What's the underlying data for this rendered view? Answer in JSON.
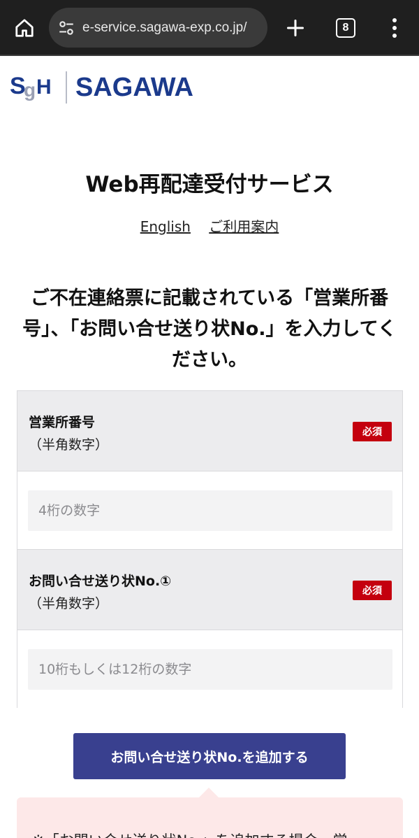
{
  "browser": {
    "url": "e-service.sagawa-exp.co.jp/",
    "tab_count": "8"
  },
  "logo": {
    "text": "SAGAWA",
    "mark_text": "SgH"
  },
  "page": {
    "title": "Web再配達受付サービス",
    "links": {
      "english": "English",
      "guide": "ご利用案内"
    },
    "instruction": "ご不在連絡票に記載されている「営業所番号」、「お問い合せ送り状No.」を入力してください。"
  },
  "form": {
    "fields": [
      {
        "label": "営業所番号",
        "sub_label": "（半角数字）",
        "required_label": "必須",
        "placeholder": "4桁の数字",
        "value": ""
      },
      {
        "label": "お問い合せ送り状No.①",
        "sub_label": "（半角数字）",
        "required_label": "必須",
        "placeholder": "10桁もしくは12桁の数字",
        "value": ""
      }
    ],
    "add_button_label": "お問い合せ送り状No.を追加する"
  },
  "note": {
    "text": "※「お問い合せ送り状No.」を追加する場合、営"
  },
  "colors": {
    "brand_navy": "#1b3a8c",
    "button": "#39408f",
    "required": "#c4000e",
    "note_bg": "#fde8e8"
  }
}
